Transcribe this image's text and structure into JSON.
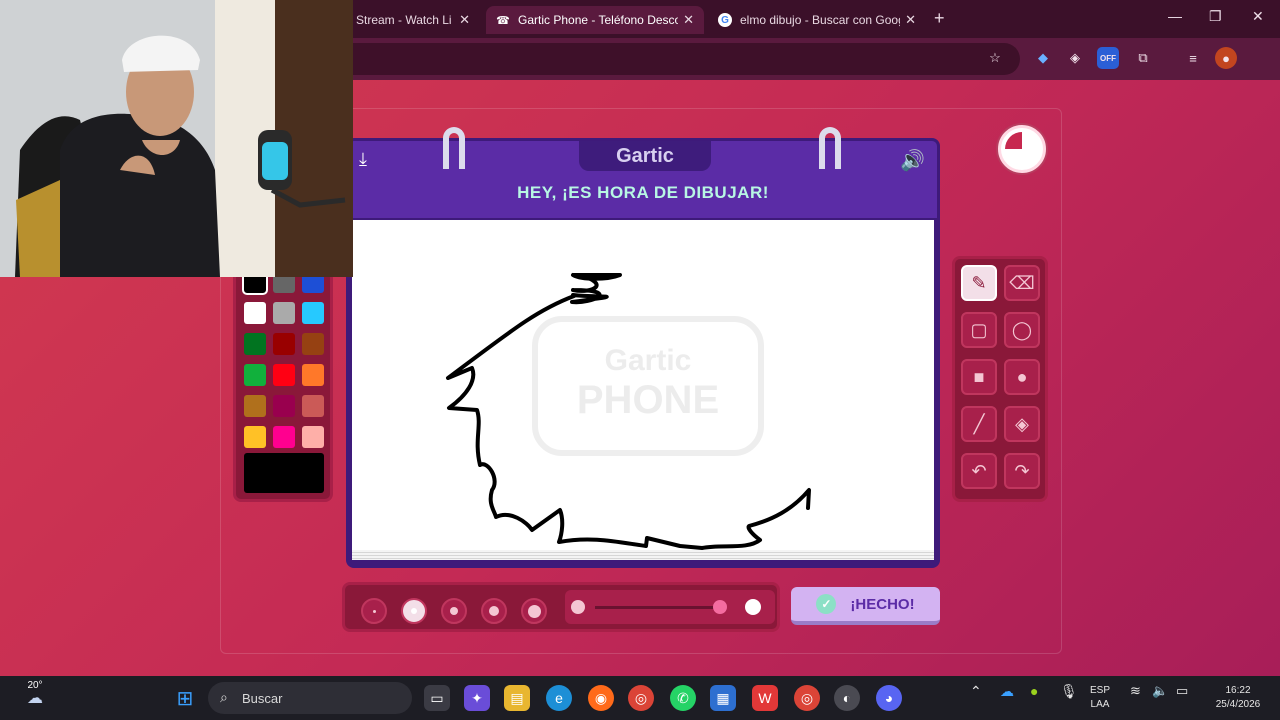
{
  "browser": {
    "tabs": [
      {
        "title": "Stream - Watch Li",
        "favicon": "stream-icon"
      },
      {
        "title": "Gartic Phone - Teléfono Descon",
        "favicon": "gartic-phone-icon",
        "active": true
      },
      {
        "title": "elmo dibujo - Buscar con Goog",
        "favicon": "google-icon"
      }
    ],
    "new_tab": "+",
    "window_controls": [
      "—",
      "❐",
      "✕"
    ],
    "toolbar_icons": [
      "star-icon",
      "extension-icon",
      "diamond-icon",
      "off-badge-icon",
      "puzzle-icon",
      "media-icon",
      "profile-icon"
    ],
    "off_badge": "OFF"
  },
  "game": {
    "logo": "Gartic",
    "heading": "HEY, ¡ES HORA DE DIBUJAR!",
    "watermark_line1": "Gartic",
    "watermark_line2": "PHONE",
    "done_button": "¡HECHO!",
    "selected_color": "#000000",
    "palette": [
      "#000000",
      "#666666",
      "#1d4fd6",
      "#ffffff",
      "#aaaaaa",
      "#26c9ff",
      "#017420",
      "#990000",
      "#964112",
      "#11b03c",
      "#ff0013",
      "#ff7829",
      "#b0701c",
      "#99004e",
      "#cb5a57",
      "#ffc126",
      "#ff008f",
      "#feafa8"
    ],
    "tools": [
      {
        "name": "pencil-tool",
        "glyph": "✎",
        "selected": true
      },
      {
        "name": "eraser-tool",
        "glyph": "⌫"
      },
      {
        "name": "rectangle-outline-tool",
        "glyph": "▢"
      },
      {
        "name": "ellipse-outline-tool",
        "glyph": "◯"
      },
      {
        "name": "rectangle-fill-tool",
        "glyph": "■"
      },
      {
        "name": "ellipse-fill-tool",
        "glyph": "●"
      },
      {
        "name": "line-tool",
        "glyph": "╱"
      },
      {
        "name": "fill-bucket-tool",
        "glyph": "◈"
      },
      {
        "name": "undo-tool",
        "glyph": "↶"
      },
      {
        "name": "redo-tool",
        "glyph": "↷"
      }
    ],
    "brush_sizes_selected": 2,
    "opacity_level": 1.0
  },
  "taskbar": {
    "weather_temp": "20°",
    "search_label": "Buscar",
    "language": "ESP",
    "layout": "LAA",
    "time": "16:22",
    "date": "25/4/2026"
  }
}
